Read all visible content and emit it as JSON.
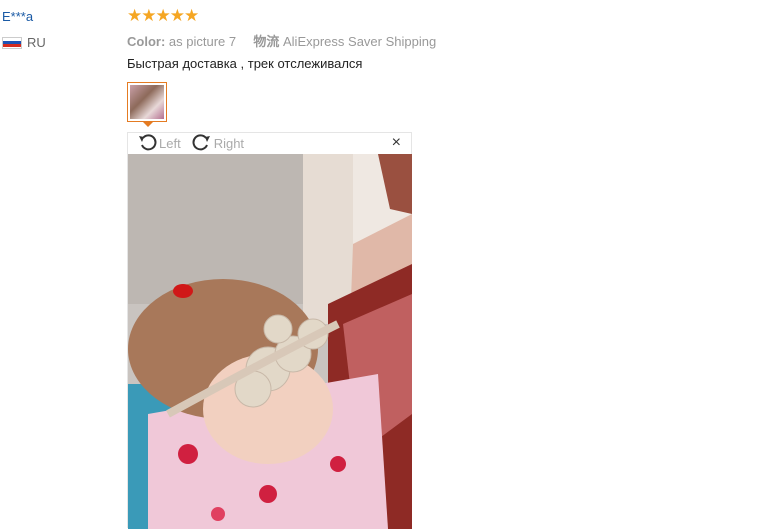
{
  "user": {
    "name": "E***a",
    "country_code": "RU",
    "flag_colors": [
      "#ffffff",
      "#1c52b5",
      "#d52b1e"
    ]
  },
  "review": {
    "stars": "★★★★★",
    "rating": 5,
    "color_label": "Color:",
    "color_value": "as picture 7",
    "shipping_label": "物流",
    "shipping_value": "AliExpress Saver Shipping",
    "text": "Быстрая доставка , трек отслеживался"
  },
  "viewer": {
    "rotate_left_label": "Left",
    "rotate_right_label": "Right",
    "close_symbol": "×",
    "rotate_left_icon": "rotate-left-icon",
    "rotate_right_icon": "rotate-right-icon",
    "close_icon": "close-icon"
  },
  "colors": {
    "star": "#f5a623",
    "thumb_border": "#e47b22",
    "username": "#1a5aa5"
  }
}
